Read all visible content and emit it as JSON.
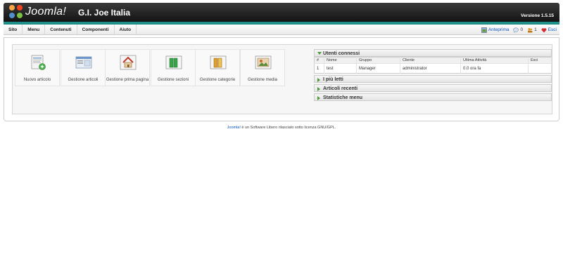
{
  "header": {
    "logo_text": "Joomla!",
    "site_title": "G.I. Joe Italia",
    "version": "Versione 1.5.15"
  },
  "menu": [
    "Sito",
    "Menu",
    "Contenuti",
    "Componenti",
    "Aiuto"
  ],
  "status": {
    "preview": "Anteprima",
    "messages": "0",
    "users": "1",
    "logout": "Esci"
  },
  "cpanel": [
    {
      "label": "Nuovo articolo",
      "icon": "new-article-icon"
    },
    {
      "label": "Gestione articoli",
      "icon": "article-manager-icon"
    },
    {
      "label": "Gestione prima pagina",
      "icon": "frontpage-manager-icon"
    },
    {
      "label": "Gestione sezioni",
      "icon": "section-manager-icon"
    },
    {
      "label": "Gestione categorie",
      "icon": "category-manager-icon"
    },
    {
      "label": "Gestione media",
      "icon": "media-manager-icon"
    }
  ],
  "panels": {
    "logged_users": {
      "title": "Utenti connessi",
      "columns": [
        "#",
        "Nome",
        "Gruppo",
        "Cliente",
        "Ultima Attività",
        "Esci"
      ],
      "rows": [
        [
          "1",
          "test",
          "Manager",
          "administrator",
          "0.0 ora fa",
          ""
        ]
      ]
    },
    "popular": "I più letti",
    "recent": "Articoli recenti",
    "stats": "Statistiche menu"
  },
  "footer": {
    "link": "Joomla!",
    "text": " è un Software Libero rilasciato sotto licenza GNU/GPL."
  },
  "colors": {
    "header_dark": "#0f0f0f",
    "stripe": "#1f8f8a",
    "link": "#0b55c4",
    "arrow": "#4a9a3a"
  }
}
